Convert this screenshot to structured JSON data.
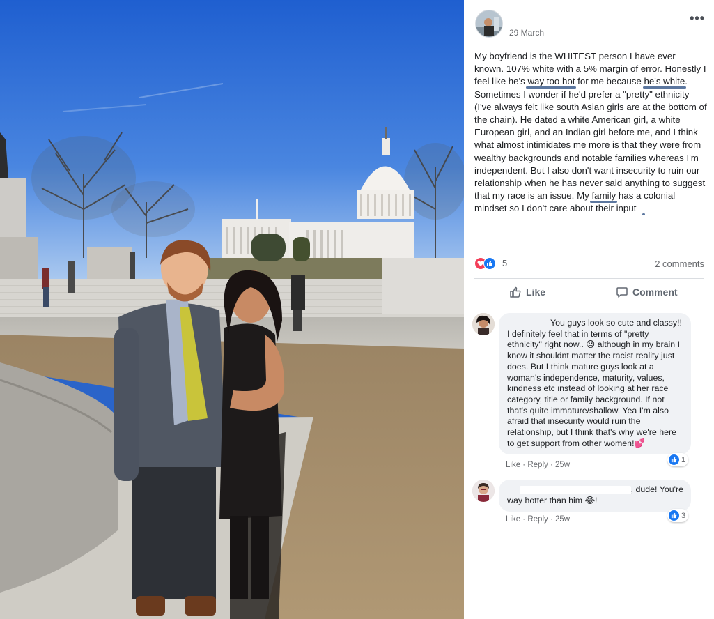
{
  "post": {
    "date": "29 March",
    "more_icon": "more-options-icon",
    "text": {
      "p1": "My boyfriend is the WHITEST person I have ever known. 107% white with a 5% margin of error. Honestly I feel like he's ",
      "u1": "way too hot",
      "p2": " for me because ",
      "u2": "he's white",
      "p3": ". Sometimes I wonder if he'd prefer a \"pretty\" ethnicity (I've always felt like south Asian girls are at the bottom of the chain). He dated a white American girl, a white European girl, and an Indian girl before me, and I think what almost intimidates me more is that they were from wealthy backgrounds and notable families whereas I'm independent. But I also don't want insecurity to ruin our relationship when he has never said anything to suggest that my race is an issue. My ",
      "u3": "family",
      "p4": " has a ",
      "u4": "colonial mindset",
      "p5": " so I don't care about their input"
    },
    "reaction_count": "5",
    "comments_label": "2 comments",
    "like_label": "Like",
    "comment_label": "Comment"
  },
  "comments": [
    {
      "text": "You guys look so cute and classy!! I definitely feel that in terms of \"pretty ethnicity\" right now.. 😓 although in my brain I know it shouldnt matter the racist reality just does. But I think mature guys look at a woman's independence, maturity, values, kindness etc instead of looking at her race category, title or family background. If not that's quite immature/shallow. Yea I'm also afraid that insecurity would ruin the relationship, but I think that's why we're here to get support from other women!💕",
      "like": "Like",
      "reply": "Reply",
      "time": "25w",
      "reactions": "1"
    },
    {
      "text_a": ", dude! You're",
      "text_b": "way hotter than him 😂!",
      "like": "Like",
      "reply": "Reply",
      "time": "25w",
      "reactions": "3"
    }
  ],
  "colors": {
    "accent": "#1877f2",
    "love": "#f33e58",
    "underline": "#3f5f8e",
    "bubble": "#f0f2f5",
    "meta": "#65676b"
  }
}
